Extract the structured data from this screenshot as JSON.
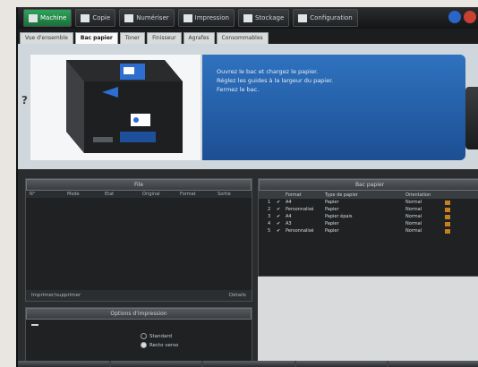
{
  "sysbar": {
    "items": [
      {
        "label": "Machine",
        "active": true
      },
      {
        "label": "Copie",
        "active": false
      },
      {
        "label": "Numériser",
        "active": false
      },
      {
        "label": "Impression",
        "active": false
      },
      {
        "label": "Stockage",
        "active": false
      },
      {
        "label": "Configuration",
        "active": false
      }
    ]
  },
  "tabs": [
    "Vue d'ensemble",
    "Bac papier",
    "Toner",
    "Finisseur",
    "Agrafes",
    "Consommables"
  ],
  "active_tab_index": 1,
  "info": {
    "help_symbol": "?",
    "message_lines": [
      "Ouvrez le bac et chargez le papier.",
      "Réglez les guides à la largeur du papier.",
      "Fermez le bac."
    ]
  },
  "queue_panel": {
    "title": "File",
    "headers": [
      "N°",
      "Mode",
      "Etat",
      "Original",
      "Format",
      "Sortie"
    ],
    "footer_left": "Imprimer/supprimer",
    "footer_right": "Détails"
  },
  "tray_panel": {
    "title": "Bac papier",
    "headers": [
      "",
      "",
      "Format",
      "Type de papier",
      "Orientation"
    ],
    "rows": [
      {
        "num": "1",
        "size": "A4",
        "type": "Papier",
        "rot": "Normal"
      },
      {
        "num": "2",
        "size": "Personnalisé",
        "type": "Papier",
        "rot": "Normal"
      },
      {
        "num": "3",
        "size": "A4",
        "type": "Papier épais",
        "rot": "Normal"
      },
      {
        "num": "4",
        "size": "A3",
        "type": "Papier",
        "rot": "Normal"
      },
      {
        "num": "5",
        "size": "Personnalisé",
        "type": "Papier",
        "rot": "Normal"
      }
    ]
  },
  "options_panel": {
    "title": "Options d'impression",
    "opt1": "Standard",
    "opt2": "Recto verso"
  },
  "footer": [
    "",
    "",
    "",
    "",
    ""
  ],
  "colors": {
    "accent_blue": "#2f72bf",
    "active_green": "#2ea35a",
    "tray_indicator": "#c7801f"
  }
}
